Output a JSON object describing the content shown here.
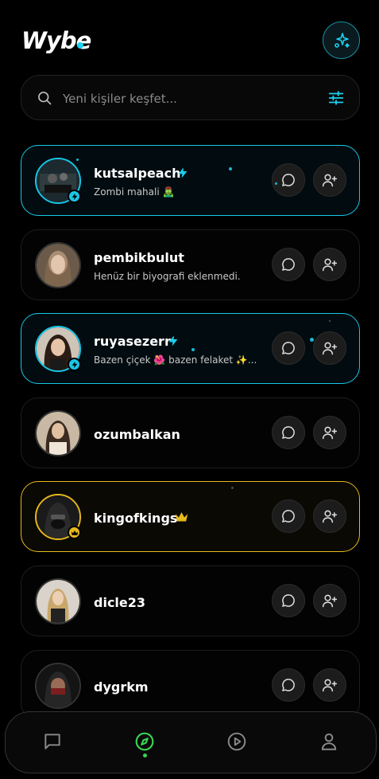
{
  "app": {
    "name": "Wybe",
    "accent": "#19d3f0",
    "gold": "#e6b91e",
    "nav_active": "#39d353"
  },
  "header": {
    "logo": "Wybe",
    "action_icon": "sparkle-icon"
  },
  "search": {
    "placeholder": "Yeni kişiler keşfet...",
    "value": ""
  },
  "users": [
    {
      "username": "kutsalpeach",
      "bio": "Zombi mahali 🧟‍♂️",
      "tier": "cyan",
      "tier_icon": "lightning-icon"
    },
    {
      "username": "pembikbulut",
      "bio": "Henüz bir biyografi eklenmedi.",
      "tier": "none"
    },
    {
      "username": "ruyasezerr",
      "bio": "Bazen çiçek 🌺 bazen felaket ✨...",
      "tier": "cyan",
      "tier_icon": "lightning-icon"
    },
    {
      "username": "ozumbalkan",
      "bio": "",
      "tier": "none"
    },
    {
      "username": "kingofkings",
      "bio": "",
      "tier": "gold",
      "tier_icon": "crown-icon"
    },
    {
      "username": "dicle23",
      "bio": "",
      "tier": "none"
    },
    {
      "username": "dygrkm",
      "bio": "",
      "tier": "none"
    }
  ],
  "actions": {
    "message_icon": "chat-bubble-icon",
    "add_icon": "add-user-icon"
  },
  "bottom_nav": [
    {
      "id": "messages",
      "icon": "chat-icon",
      "active": false
    },
    {
      "id": "discover",
      "icon": "compass-icon",
      "active": true
    },
    {
      "id": "videos",
      "icon": "play-circle-icon",
      "active": false
    },
    {
      "id": "profile",
      "icon": "person-icon",
      "active": false
    }
  ]
}
